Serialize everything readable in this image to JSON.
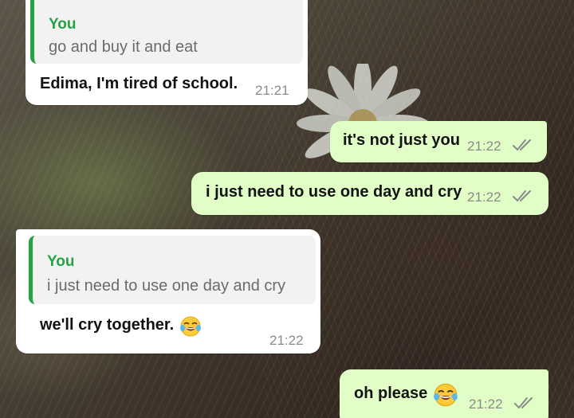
{
  "messages": [
    {
      "direction": "incoming",
      "quote_author": "You",
      "quote_text": "go and buy it and eat",
      "text": "Edima, I'm tired of school.",
      "time": "21:21"
    },
    {
      "direction": "outgoing",
      "text": "it's not just you",
      "time": "21:22",
      "status_icon": "double-check-icon"
    },
    {
      "direction": "outgoing",
      "text": "i just need to use one day and cry",
      "time": "21:22",
      "status_icon": "double-check-icon"
    },
    {
      "direction": "incoming",
      "quote_author": "You",
      "quote_text": "i just need to use one day and cry",
      "text": "we'll cry together.",
      "emoji": "tears-of-joy-emoji",
      "time": "21:22"
    },
    {
      "direction": "outgoing",
      "text": "oh please",
      "emoji": "tears-of-joy-emoji",
      "time": "21:22",
      "status_icon": "double-check-icon"
    }
  ],
  "colors": {
    "incoming_bubble": "#ffffff",
    "outgoing_bubble": "#e1fec6",
    "quote_accent": "#25a244",
    "time_text": "#8a8a8a"
  }
}
